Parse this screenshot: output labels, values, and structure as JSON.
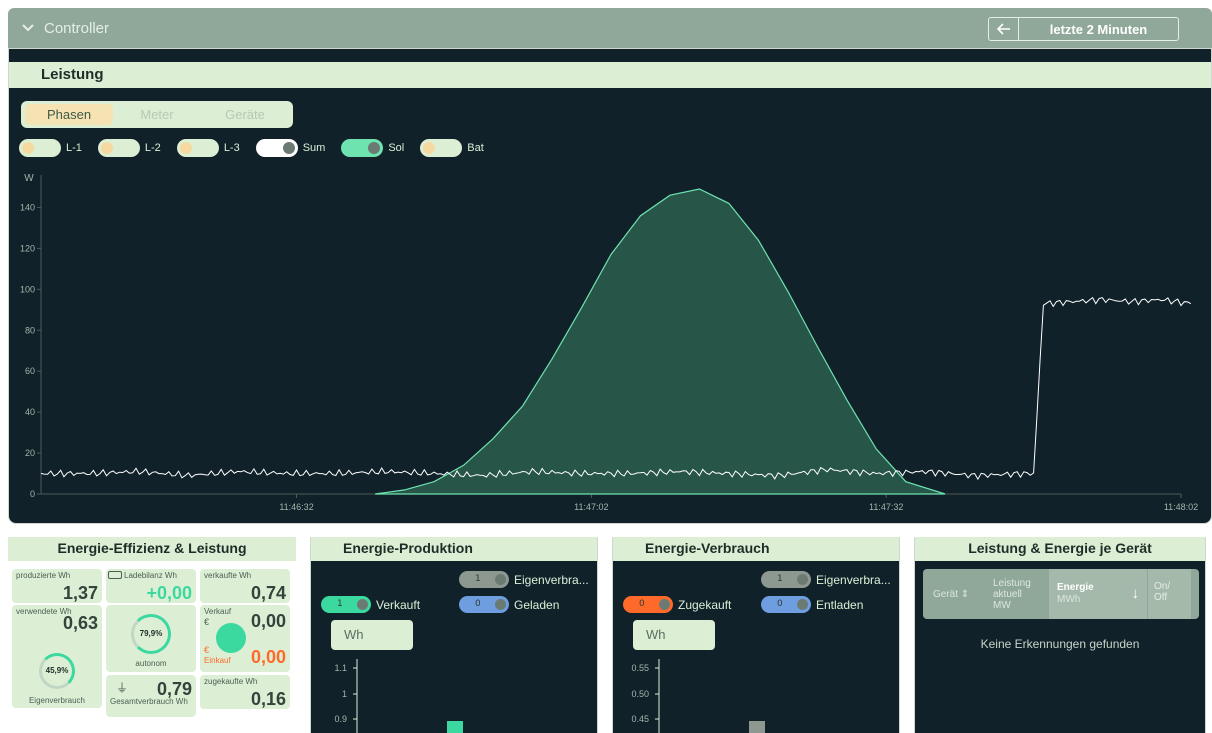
{
  "controller": {
    "title": "Controller",
    "time_range": "letzte 2 Minuten"
  },
  "leistung": {
    "title": "Leistung",
    "tabs": [
      {
        "label": "Phasen",
        "active": true
      },
      {
        "label": "Meter",
        "active": false
      },
      {
        "label": "Geräte",
        "active": false
      }
    ],
    "toggles": [
      {
        "label": "L-1",
        "state": "off",
        "color": "#f6d9a0"
      },
      {
        "label": "L-2",
        "state": "off",
        "color": "#f6d9a0"
      },
      {
        "label": "L-3",
        "state": "off",
        "color": "#f6d9a0"
      },
      {
        "label": "Sum",
        "state": "on",
        "color": "#ffffff"
      },
      {
        "label": "Sol",
        "state": "on",
        "color": "#6ee3b0"
      },
      {
        "label": "Bat",
        "state": "off",
        "color": "#f6d9a0"
      }
    ]
  },
  "chart_data": {
    "type": "area",
    "ylabel": "W",
    "ylim": [
      0,
      150
    ],
    "yticks": [
      "0",
      "20",
      "40",
      "60",
      "80",
      "100",
      "120",
      "140"
    ],
    "xticks": [
      "11:46:32",
      "11:47:02",
      "11:47:32",
      "11:48:02"
    ],
    "x_range_seconds": [
      0,
      116
    ],
    "series": [
      {
        "color": "#6ee3b0",
        "x": [
          34,
          37,
          40,
          43,
          46,
          49,
          52,
          55,
          58,
          61,
          64,
          67,
          70,
          73,
          76,
          79,
          82,
          85,
          88,
          92
        ],
        "y": [
          0,
          2,
          6,
          14,
          27,
          43,
          66,
          91,
          117,
          136,
          146,
          149,
          142,
          124,
          99,
          72,
          46,
          22,
          6,
          0
        ]
      },
      {
        "color": "#ffffff",
        "x": [
          0,
          5,
          10,
          15,
          20,
          25,
          30,
          35,
          40,
          45,
          50,
          55,
          60,
          65,
          70,
          75,
          80,
          85,
          90,
          95,
          100,
          101,
          102,
          105,
          108,
          111,
          114,
          117
        ],
        "y": [
          10,
          10,
          11,
          9,
          11,
          10,
          10,
          11,
          10,
          9,
          11,
          10,
          10,
          11,
          10,
          9,
          12,
          10,
          11,
          9,
          10,
          10,
          93,
          94,
          95,
          94,
          95,
          93
        ]
      }
    ]
  },
  "effizienz": {
    "title": "Energie-Effizienz & Leistung",
    "produziert": {
      "label": "produzierte Wh",
      "value": "1,37"
    },
    "ladebilanz": {
      "label": "Ladebilanz Wh",
      "value": "+0,00"
    },
    "verkaufte": {
      "label": "verkaufte Wh",
      "value": "0,74"
    },
    "verwendete": {
      "label": "verwendete Wh",
      "value": "0,63"
    },
    "autonom": {
      "label": "autonom",
      "value": "79,9%"
    },
    "verkauf": {
      "label": "Verkauf",
      "currency": "€",
      "value": "0,00"
    },
    "einkauf": {
      "label": "Einkauf",
      "currency": "€",
      "value": "0,00"
    },
    "eigenverbrauch": {
      "label": "Eigenverbrauch",
      "value": "45,9%"
    },
    "gesamtverbrauch": {
      "label": "Gesamtverbrauch Wh",
      "value": "0,79"
    },
    "zugekaufte": {
      "label": "zugekaufte Wh",
      "value": "0,16"
    }
  },
  "produktion": {
    "title": "Energie-Produktion",
    "toggles": [
      {
        "label": "Eigenverbra...",
        "value": "1"
      },
      {
        "label": "Verkauft",
        "value": "1"
      },
      {
        "label": "Geladen",
        "value": "0"
      }
    ],
    "unit": "Wh",
    "yticks": [
      "1.1",
      "1",
      "0.9"
    ]
  },
  "verbrauch": {
    "title": "Energie-Verbrauch",
    "toggles": [
      {
        "label": "Eigenverbra...",
        "value": "1"
      },
      {
        "label": "Zugekauft",
        "value": "0"
      },
      {
        "label": "Entladen",
        "value": "0"
      }
    ],
    "unit": "Wh",
    "yticks": [
      "0.55",
      "0.50",
      "0.45"
    ]
  },
  "geraete": {
    "title": "Leistung & Energie je Gerät",
    "columns": {
      "geraet": "Gerät",
      "leistung_1": "Leistung",
      "leistung_2": "aktuell",
      "leistung_3": "MW",
      "energie": "Energie",
      "energie_unit": "MWh",
      "onoff_1": "On/",
      "onoff_2": "Off"
    },
    "empty": "Keine Erkennungen gefunden"
  }
}
